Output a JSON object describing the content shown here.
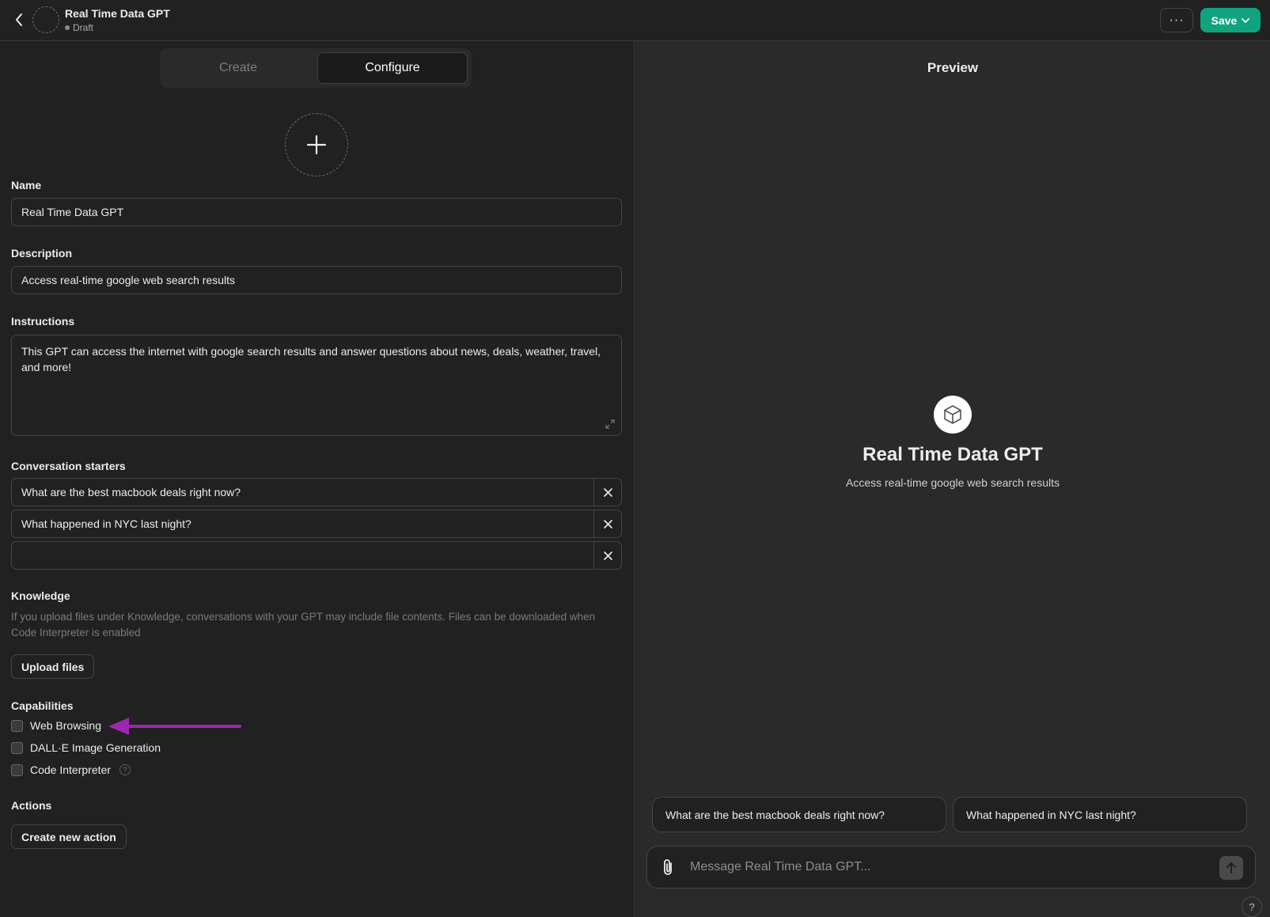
{
  "header": {
    "title": "Real Time Data GPT",
    "status": "Draft",
    "more_label": "···",
    "save_label": "Save"
  },
  "tabs": [
    {
      "label": "Create",
      "active": false
    },
    {
      "label": "Configure",
      "active": true
    }
  ],
  "form": {
    "name_label": "Name",
    "name_value": "Real Time Data GPT",
    "description_label": "Description",
    "description_value": "Access real-time google web search results",
    "instructions_label": "Instructions",
    "instructions_value": "This GPT can access the internet with google search results and answer questions about news, deals, weather, travel, and more!",
    "starters_label": "Conversation starters",
    "starters": [
      "What are the best macbook deals right now?",
      "What happened in NYC last night?",
      ""
    ],
    "knowledge_label": "Knowledge",
    "knowledge_note": "If you upload files under Knowledge, conversations with your GPT may include file contents. Files can be downloaded when Code Interpreter is enabled",
    "upload_label": "Upload files",
    "capabilities_label": "Capabilities",
    "capabilities": [
      {
        "label": "Web Browsing",
        "checked": false
      },
      {
        "label": "DALL·E Image Generation",
        "checked": false
      },
      {
        "label": "Code Interpreter",
        "checked": false
      }
    ],
    "actions_label": "Actions",
    "create_action_label": "Create new action"
  },
  "preview": {
    "title": "Preview",
    "name": "Real Time Data GPT",
    "description": "Access real-time google web search results",
    "starters": [
      "What are the best macbook deals right now?",
      "What happened in NYC last night?"
    ],
    "message_placeholder": "Message Real Time Data GPT...",
    "help_label": "?"
  },
  "colors": {
    "accent": "#10a37f",
    "annotation_arrow": "#9b27b0"
  }
}
